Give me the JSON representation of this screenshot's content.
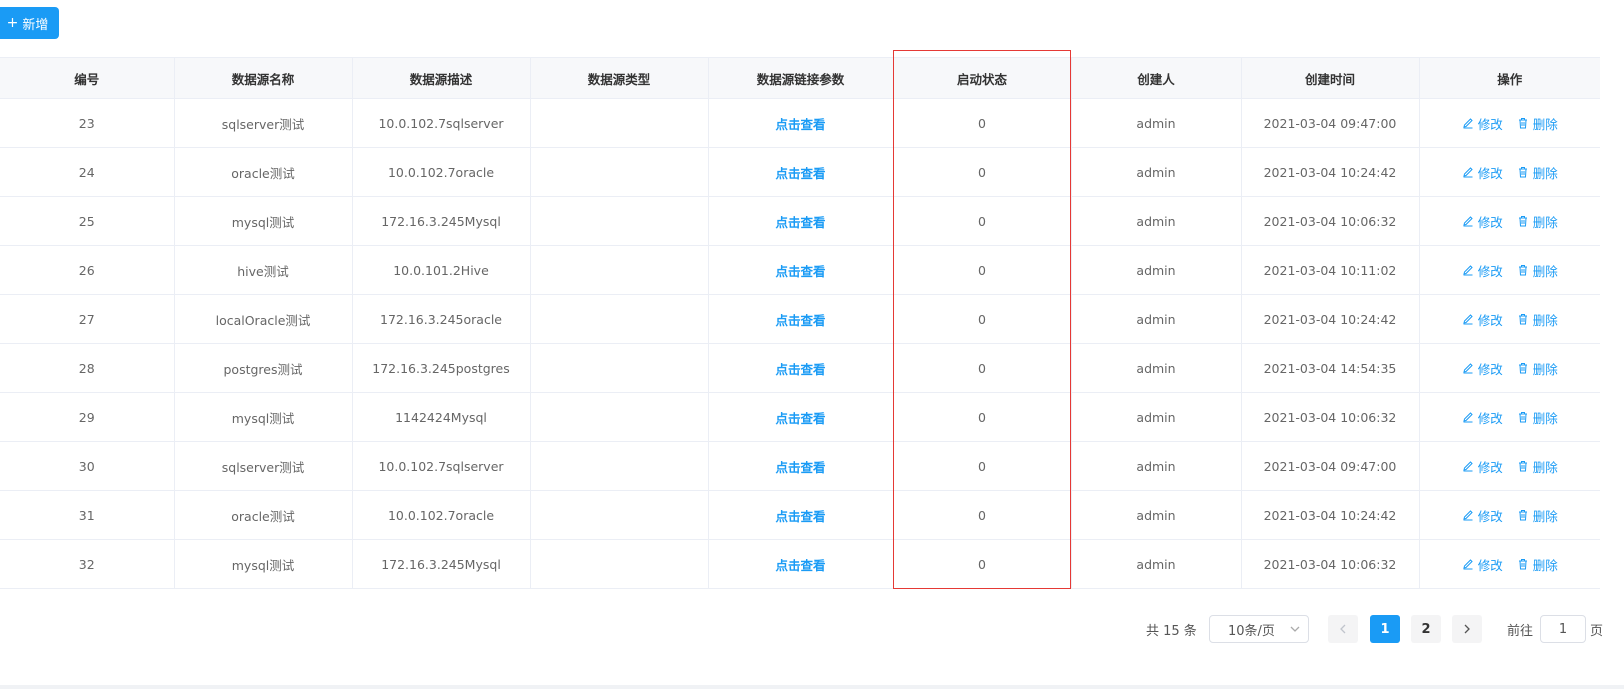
{
  "toolbar": {
    "add_label": "新增"
  },
  "table": {
    "headers": [
      "编号",
      "数据源名称",
      "数据源描述",
      "数据源类型",
      "数据源链接参数",
      "启动状态",
      "创建人",
      "创建时间",
      "操作"
    ],
    "link_label": "点击查看",
    "edit_label": "修改",
    "delete_label": "删除",
    "rows": [
      {
        "id": "23",
        "name": "sqlserver测试",
        "desc": "10.0.102.7sqlserver",
        "type": "",
        "status": "0",
        "creator": "admin",
        "created": "2021-03-04 09:47:00"
      },
      {
        "id": "24",
        "name": "oracle测试",
        "desc": "10.0.102.7oracle",
        "type": "",
        "status": "0",
        "creator": "admin",
        "created": "2021-03-04 10:24:42"
      },
      {
        "id": "25",
        "name": "mysql测试",
        "desc": "172.16.3.245Mysql",
        "type": "",
        "status": "0",
        "creator": "admin",
        "created": "2021-03-04 10:06:32"
      },
      {
        "id": "26",
        "name": "hive测试",
        "desc": "10.0.101.2Hive",
        "type": "",
        "status": "0",
        "creator": "admin",
        "created": "2021-03-04 10:11:02"
      },
      {
        "id": "27",
        "name": "localOracle测试",
        "desc": "172.16.3.245oracle",
        "type": "",
        "status": "0",
        "creator": "admin",
        "created": "2021-03-04 10:24:42"
      },
      {
        "id": "28",
        "name": "postgres测试",
        "desc": "172.16.3.245postgres",
        "type": "",
        "status": "0",
        "creator": "admin",
        "created": "2021-03-04 14:54:35"
      },
      {
        "id": "29",
        "name": "mysql测试",
        "desc": "1142424Mysql",
        "type": "",
        "status": "0",
        "creator": "admin",
        "created": "2021-03-04 10:06:32"
      },
      {
        "id": "30",
        "name": "sqlserver测试",
        "desc": "10.0.102.7sqlserver",
        "type": "",
        "status": "0",
        "creator": "admin",
        "created": "2021-03-04 09:47:00"
      },
      {
        "id": "31",
        "name": "oracle测试",
        "desc": "10.0.102.7oracle",
        "type": "",
        "status": "0",
        "creator": "admin",
        "created": "2021-03-04 10:24:42"
      },
      {
        "id": "32",
        "name": "mysql测试",
        "desc": "172.16.3.245Mysql",
        "type": "",
        "status": "0",
        "creator": "admin",
        "created": "2021-03-04 10:06:32"
      }
    ]
  },
  "pagination": {
    "total_text": "共 15 条",
    "page_size": "10条/页",
    "pages": [
      "1",
      "2"
    ],
    "current_page": "1",
    "goto_label": "前往",
    "goto_value": "1",
    "page_suffix": "页"
  },
  "colors": {
    "accent": "#1a9bf5",
    "highlight": "#e53935"
  }
}
